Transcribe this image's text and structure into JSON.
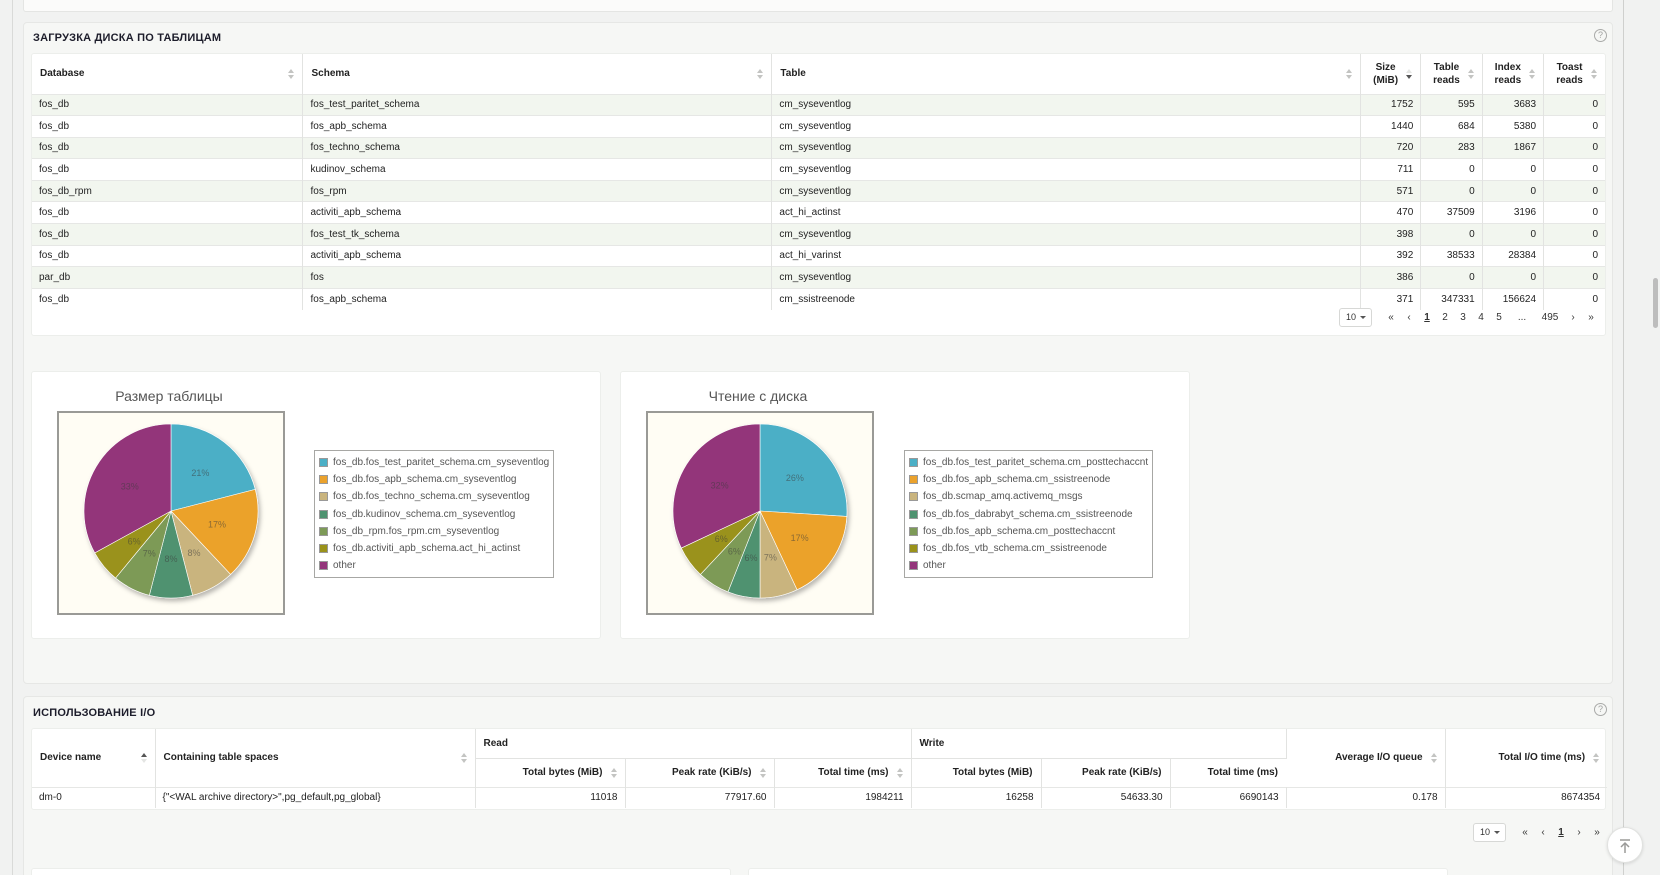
{
  "disk_section": {
    "title": "ЗАГРУЗКА ДИСКА ПО ТАБЛИЦАМ",
    "help": "?",
    "columns": {
      "database": "Database",
      "schema": "Schema",
      "table": "Table",
      "size_l1": "Size",
      "size_l2": "(MiB)",
      "table_reads_l1": "Table",
      "table_reads_l2": "reads",
      "index_reads_l1": "Index",
      "index_reads_l2": "reads",
      "toast_reads_l1": "Toast",
      "toast_reads_l2": "reads"
    },
    "rows": [
      {
        "db": "fos_db",
        "schema": "fos_test_paritet_schema",
        "table": "cm_syseventlog",
        "size": "1752",
        "treads": "595",
        "ireads": "3683",
        "toast": "0"
      },
      {
        "db": "fos_db",
        "schema": "fos_apb_schema",
        "table": "cm_syseventlog",
        "size": "1440",
        "treads": "684",
        "ireads": "5380",
        "toast": "0"
      },
      {
        "db": "fos_db",
        "schema": "fos_techno_schema",
        "table": "cm_syseventlog",
        "size": "720",
        "treads": "283",
        "ireads": "1867",
        "toast": "0"
      },
      {
        "db": "fos_db",
        "schema": "kudinov_schema",
        "table": "cm_syseventlog",
        "size": "711",
        "treads": "0",
        "ireads": "0",
        "toast": "0"
      },
      {
        "db": "fos_db_rpm",
        "schema": "fos_rpm",
        "table": "cm_syseventlog",
        "size": "571",
        "treads": "0",
        "ireads": "0",
        "toast": "0"
      },
      {
        "db": "fos_db",
        "schema": "activiti_apb_schema",
        "table": "act_hi_actinst",
        "size": "470",
        "treads": "37509",
        "ireads": "3196",
        "toast": "0"
      },
      {
        "db": "fos_db",
        "schema": "fos_test_tk_schema",
        "table": "cm_syseventlog",
        "size": "398",
        "treads": "0",
        "ireads": "0",
        "toast": "0"
      },
      {
        "db": "fos_db",
        "schema": "activiti_apb_schema",
        "table": "act_hi_varinst",
        "size": "392",
        "treads": "38533",
        "ireads": "28384",
        "toast": "0"
      },
      {
        "db": "par_db",
        "schema": "fos",
        "table": "cm_syseventlog",
        "size": "386",
        "treads": "0",
        "ireads": "0",
        "toast": "0"
      },
      {
        "db": "fos_db",
        "schema": "fos_apb_schema",
        "table": "cm_ssistreenode",
        "size": "371",
        "treads": "347331",
        "ireads": "156624",
        "toast": "0"
      }
    ],
    "pager": {
      "page_size": "10",
      "first": "«",
      "prev": "‹",
      "pages": [
        "1",
        "2",
        "3",
        "4",
        "5"
      ],
      "ellipsis": "...",
      "last_page": "495",
      "next": "›",
      "last": "»"
    }
  },
  "chart_data": [
    {
      "type": "pie",
      "title": "Размер таблицы",
      "labels": [
        "fos_db.fos_test_paritet_schema.cm_syseventlog",
        "fos_db.fos_apb_schema.cm_syseventlog",
        "fos_db.fos_techno_schema.cm_syseventlog",
        "fos_db.kudinov_schema.cm_syseventlog",
        "fos_db_rpm.fos_rpm.cm_syseventlog",
        "fos_db.activiti_apb_schema.act_hi_actinst",
        "other"
      ],
      "values": [
        21,
        17,
        8,
        8,
        7,
        6,
        33
      ],
      "value_labels": [
        "21%",
        "17%",
        "8%",
        "8%",
        "7%",
        "6%",
        "33%"
      ],
      "colors": [
        "#4bafc6",
        "#eba22c",
        "#c9b47e",
        "#4f9270",
        "#7d9a57",
        "#9a921a",
        "#93357a"
      ],
      "legend": "right"
    },
    {
      "type": "pie",
      "title": "Чтение с диска",
      "labels": [
        "fos_db.fos_test_paritet_schema.cm_posttechaccnt",
        "fos_db.fos_apb_schema.cm_ssistreenode",
        "fos_db.scmap_amq.activemq_msgs",
        "fos_db.fos_dabrabyt_schema.cm_ssistreenode",
        "fos_db.fos_apb_schema.cm_posttechaccnt",
        "fos_db.fos_vtb_schema.cm_ssistreenode",
        "other"
      ],
      "values": [
        26,
        17,
        7,
        6,
        6,
        6,
        32
      ],
      "value_labels": [
        "26%",
        "17%",
        "7%",
        "6%",
        "6%",
        "6%",
        "32%"
      ],
      "colors": [
        "#4bafc6",
        "#eba22c",
        "#c9b47e",
        "#4f9270",
        "#7d9a57",
        "#9a921a",
        "#93357a"
      ],
      "legend": "right"
    }
  ],
  "io_section": {
    "title": "ИСПОЛЬЗОВАНИЕ I/O",
    "help": "?",
    "columns": {
      "device": "Device name",
      "spaces": "Containing table spaces",
      "read": "Read",
      "write": "Write",
      "r_total_bytes": "Total bytes (MiB)",
      "r_peak": "Peak rate (KiB/s)",
      "r_time": "Total time (ms)",
      "w_total_bytes": "Total bytes (MiB)",
      "w_peak": "Peak rate (KiB/s)",
      "w_time": "Total time (ms)",
      "queue": "Average I/O queue",
      "io_time": "Total I/O time (ms)"
    },
    "row": {
      "device": "dm-0",
      "spaces": "{\"<WAL archive directory>\",pg_default,pg_global}",
      "r_total_bytes": "11018",
      "r_peak": "77917.60",
      "r_time": "1984211",
      "w_total_bytes": "16258",
      "w_peak": "54633.30",
      "w_time": "6690143",
      "queue": "0.178",
      "io_time": "8674354"
    },
    "pager": {
      "page_size": "10",
      "first": "«",
      "prev": "‹",
      "page": "1",
      "next": "›",
      "last": "»"
    }
  },
  "scroll_top_icon": "arrow-up-to-top-icon"
}
